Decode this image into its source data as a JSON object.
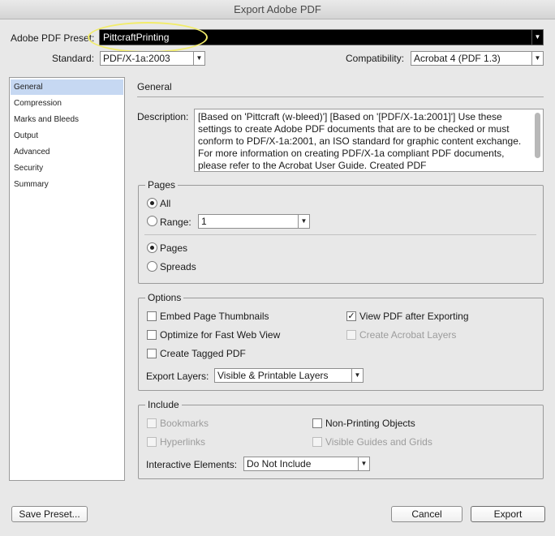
{
  "window": {
    "title": "Export Adobe PDF"
  },
  "preset": {
    "label": "Adobe PDF Preset:",
    "value": "PittcraftPrinting"
  },
  "standard": {
    "label": "Standard:",
    "value": "PDF/X-1a:2003"
  },
  "compatibility": {
    "label": "Compatibility:",
    "value": "Acrobat 4 (PDF 1.3)"
  },
  "sidebar": {
    "items": [
      {
        "label": "General"
      },
      {
        "label": "Compression"
      },
      {
        "label": "Marks and Bleeds"
      },
      {
        "label": "Output"
      },
      {
        "label": "Advanced"
      },
      {
        "label": "Security"
      },
      {
        "label": "Summary"
      }
    ]
  },
  "general": {
    "heading": "General",
    "description_label": "Description:",
    "description_text": "[Based on 'Pittcraft (w-bleed)'] [Based on '[PDF/X-1a:2001]'] Use these settings to create Adobe PDF documents that are to be checked or must conform to PDF/X-1a:2001, an ISO standard for graphic content exchange.  For more information on creating PDF/X-1a compliant PDF documents, please refer to the Acrobat User Guide.  Created PDF"
  },
  "pages": {
    "title": "Pages",
    "all_label": "All",
    "range_label": "Range:",
    "range_value": "1",
    "pages_label": "Pages",
    "spreads_label": "Spreads"
  },
  "options": {
    "title": "Options",
    "embed_thumbnails": "Embed Page Thumbnails",
    "optimize_web": "Optimize for Fast Web View",
    "tagged_pdf": "Create Tagged PDF",
    "view_after": "View PDF after Exporting",
    "acrobat_layers": "Create Acrobat Layers",
    "export_layers_label": "Export Layers:",
    "export_layers_value": "Visible & Printable Layers"
  },
  "include": {
    "title": "Include",
    "bookmarks": "Bookmarks",
    "hyperlinks": "Hyperlinks",
    "non_printing": "Non-Printing Objects",
    "guides_grids": "Visible Guides and Grids",
    "interactive_label": "Interactive Elements:",
    "interactive_value": "Do Not Include"
  },
  "buttons": {
    "save_preset": "Save Preset...",
    "cancel": "Cancel",
    "export": "Export"
  },
  "icons": {
    "dropdown": "▼",
    "check": "✓"
  },
  "colors": {
    "sidebar_selection": "#c6d8f2",
    "preset_field_bg": "#000000",
    "highlight_ring": "#f2ec6a"
  }
}
